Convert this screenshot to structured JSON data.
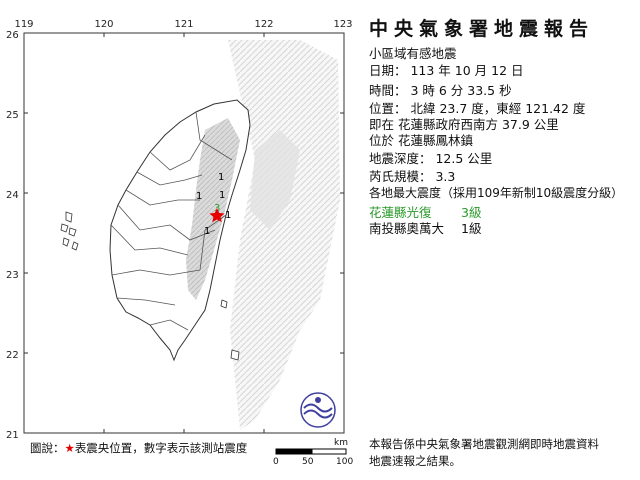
{
  "map": {
    "lon_ticks": [
      "119",
      "120",
      "121",
      "122",
      "123"
    ],
    "lat_ticks": [
      "26",
      "25",
      "24",
      "23",
      "22",
      "21"
    ],
    "epicenter_marker": "star-icon",
    "epicenter_color": "#e60000",
    "station_intensities": [
      {
        "value": "3",
        "color": "#2a9a2a"
      },
      {
        "value": "1",
        "color": "#000000"
      },
      {
        "value": "1",
        "color": "#000000"
      },
      {
        "value": "1",
        "color": "#000000"
      },
      {
        "value": "1",
        "color": "#000000"
      },
      {
        "value": "1",
        "color": "#000000"
      }
    ],
    "legend_prefix": "圖說：",
    "legend_star": "★",
    "legend_text": "表震央位置，數字表示該測站震度",
    "scale_unit": "km",
    "scale_labels": [
      "0",
      "50",
      "100"
    ],
    "logo": "cwa-logo-icon"
  },
  "report": {
    "title": "中央氣象署地震報告",
    "subtitle": "小區域有感地震",
    "date": "日期： 113 年 10 月 12 日",
    "time": "時間： 3 時 6 分 33.5 秒",
    "position": "位置： 北緯 23.7 度，東經 121.42 度",
    "relative_location": "即在 花蓮縣政府西南方 37.9 公里",
    "located_in": "位於 花蓮縣鳳林鎮",
    "depth": "地震深度： 12.5 公里",
    "magnitude": "芮氏規模： 3.3",
    "intensity_header": "各地最大震度（採用109年新制10級震度分級）",
    "stations": [
      {
        "name": "花蓮縣光復",
        "level": "3級",
        "color": "#2a9a2a"
      },
      {
        "name": "南投縣奧萬大",
        "level": "1級",
        "color": "#111111"
      }
    ],
    "footer": [
      "本報告係中央氣象署地震觀測網即時地震資料",
      "地震速報之結果。"
    ]
  }
}
